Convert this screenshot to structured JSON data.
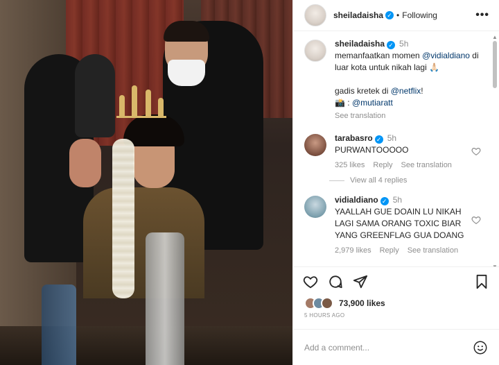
{
  "header": {
    "username": "sheiladaisha",
    "separator": "•",
    "follow_status": "Following",
    "more": "•••"
  },
  "caption": {
    "username": "sheiladaisha",
    "time": "5h",
    "text_1": "memanfaatkan momen ",
    "mention_1": "@vidialdiano",
    "text_2": " di luar kota untuk nikah lagi 🙏🏻",
    "text_3": "gadis kretek di ",
    "mention_2": "@netflix",
    "text_4": "!",
    "text_5": "📸 : ",
    "mention_3": "@mutiaratt",
    "see_translation": "See translation"
  },
  "comments": [
    {
      "username": "tarabasro",
      "time": "5h",
      "text": "PURWANTOOOOO",
      "likes": "325 likes",
      "reply": "Reply",
      "see_translation": "See translation",
      "view_replies": "View all 4 replies"
    },
    {
      "username": "vidialdiano",
      "time": "5h",
      "text": "YAALLAH GUE DOAIN LU NIKAH LAGI SAMA ORANG TOXIC BIAR YANG GREENFLAG GUA DOANG",
      "likes": "2,979 likes",
      "reply": "Reply",
      "see_translation": "See translation"
    }
  ],
  "post": {
    "likes_count": "73,900 likes",
    "time_ago": "5 HOURS AGO"
  },
  "add_comment": {
    "placeholder": "Add a comment..."
  },
  "colors": {
    "verified": "#0095f6",
    "link": "#00376b",
    "secondary_text": "#8e8e8e"
  }
}
